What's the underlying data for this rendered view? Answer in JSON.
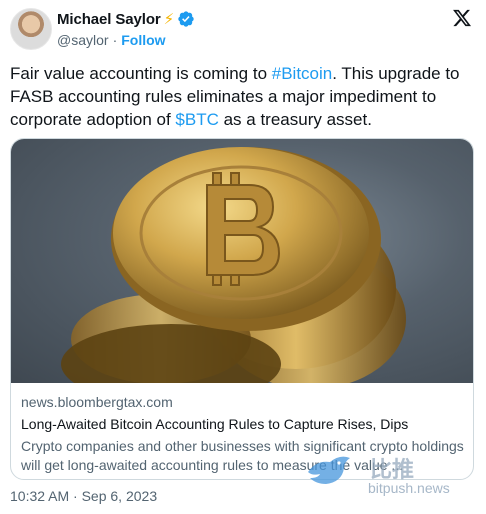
{
  "author": {
    "name": "Michael Saylor",
    "emoji": "⚡",
    "handle": "@saylor",
    "separator": "·",
    "follow_label": "Follow"
  },
  "tweet": {
    "text_1": "Fair value accounting is coming to ",
    "hashtag": "#Bitcoin",
    "text_2": ". This upgrade to FASB accounting rules eliminates a major impediment to corporate adoption of ",
    "cashtag": "$BTC",
    "text_3": " as a treasury asset."
  },
  "card": {
    "domain": "news.bloombergtax.com",
    "headline": "Long-Awaited Bitcoin Accounting Rules to Capture Rises, Dips",
    "description": "Crypto companies and other businesses with significant crypto holdings will get long-awaited accounting rules to measure the value ..."
  },
  "timestamp": "10:32 AM · Sep 6, 2023",
  "watermark": {
    "chinese": "比推",
    "site": "bitpush.news"
  },
  "colors": {
    "link": "#1d9bf0",
    "secondary_text": "#536471",
    "primary_text": "#0f1419",
    "verified": "#1d9bf0",
    "gold": "#c9a24a"
  },
  "icons": {
    "verified": "verified-badge-icon",
    "platform": "x-logo-icon"
  }
}
